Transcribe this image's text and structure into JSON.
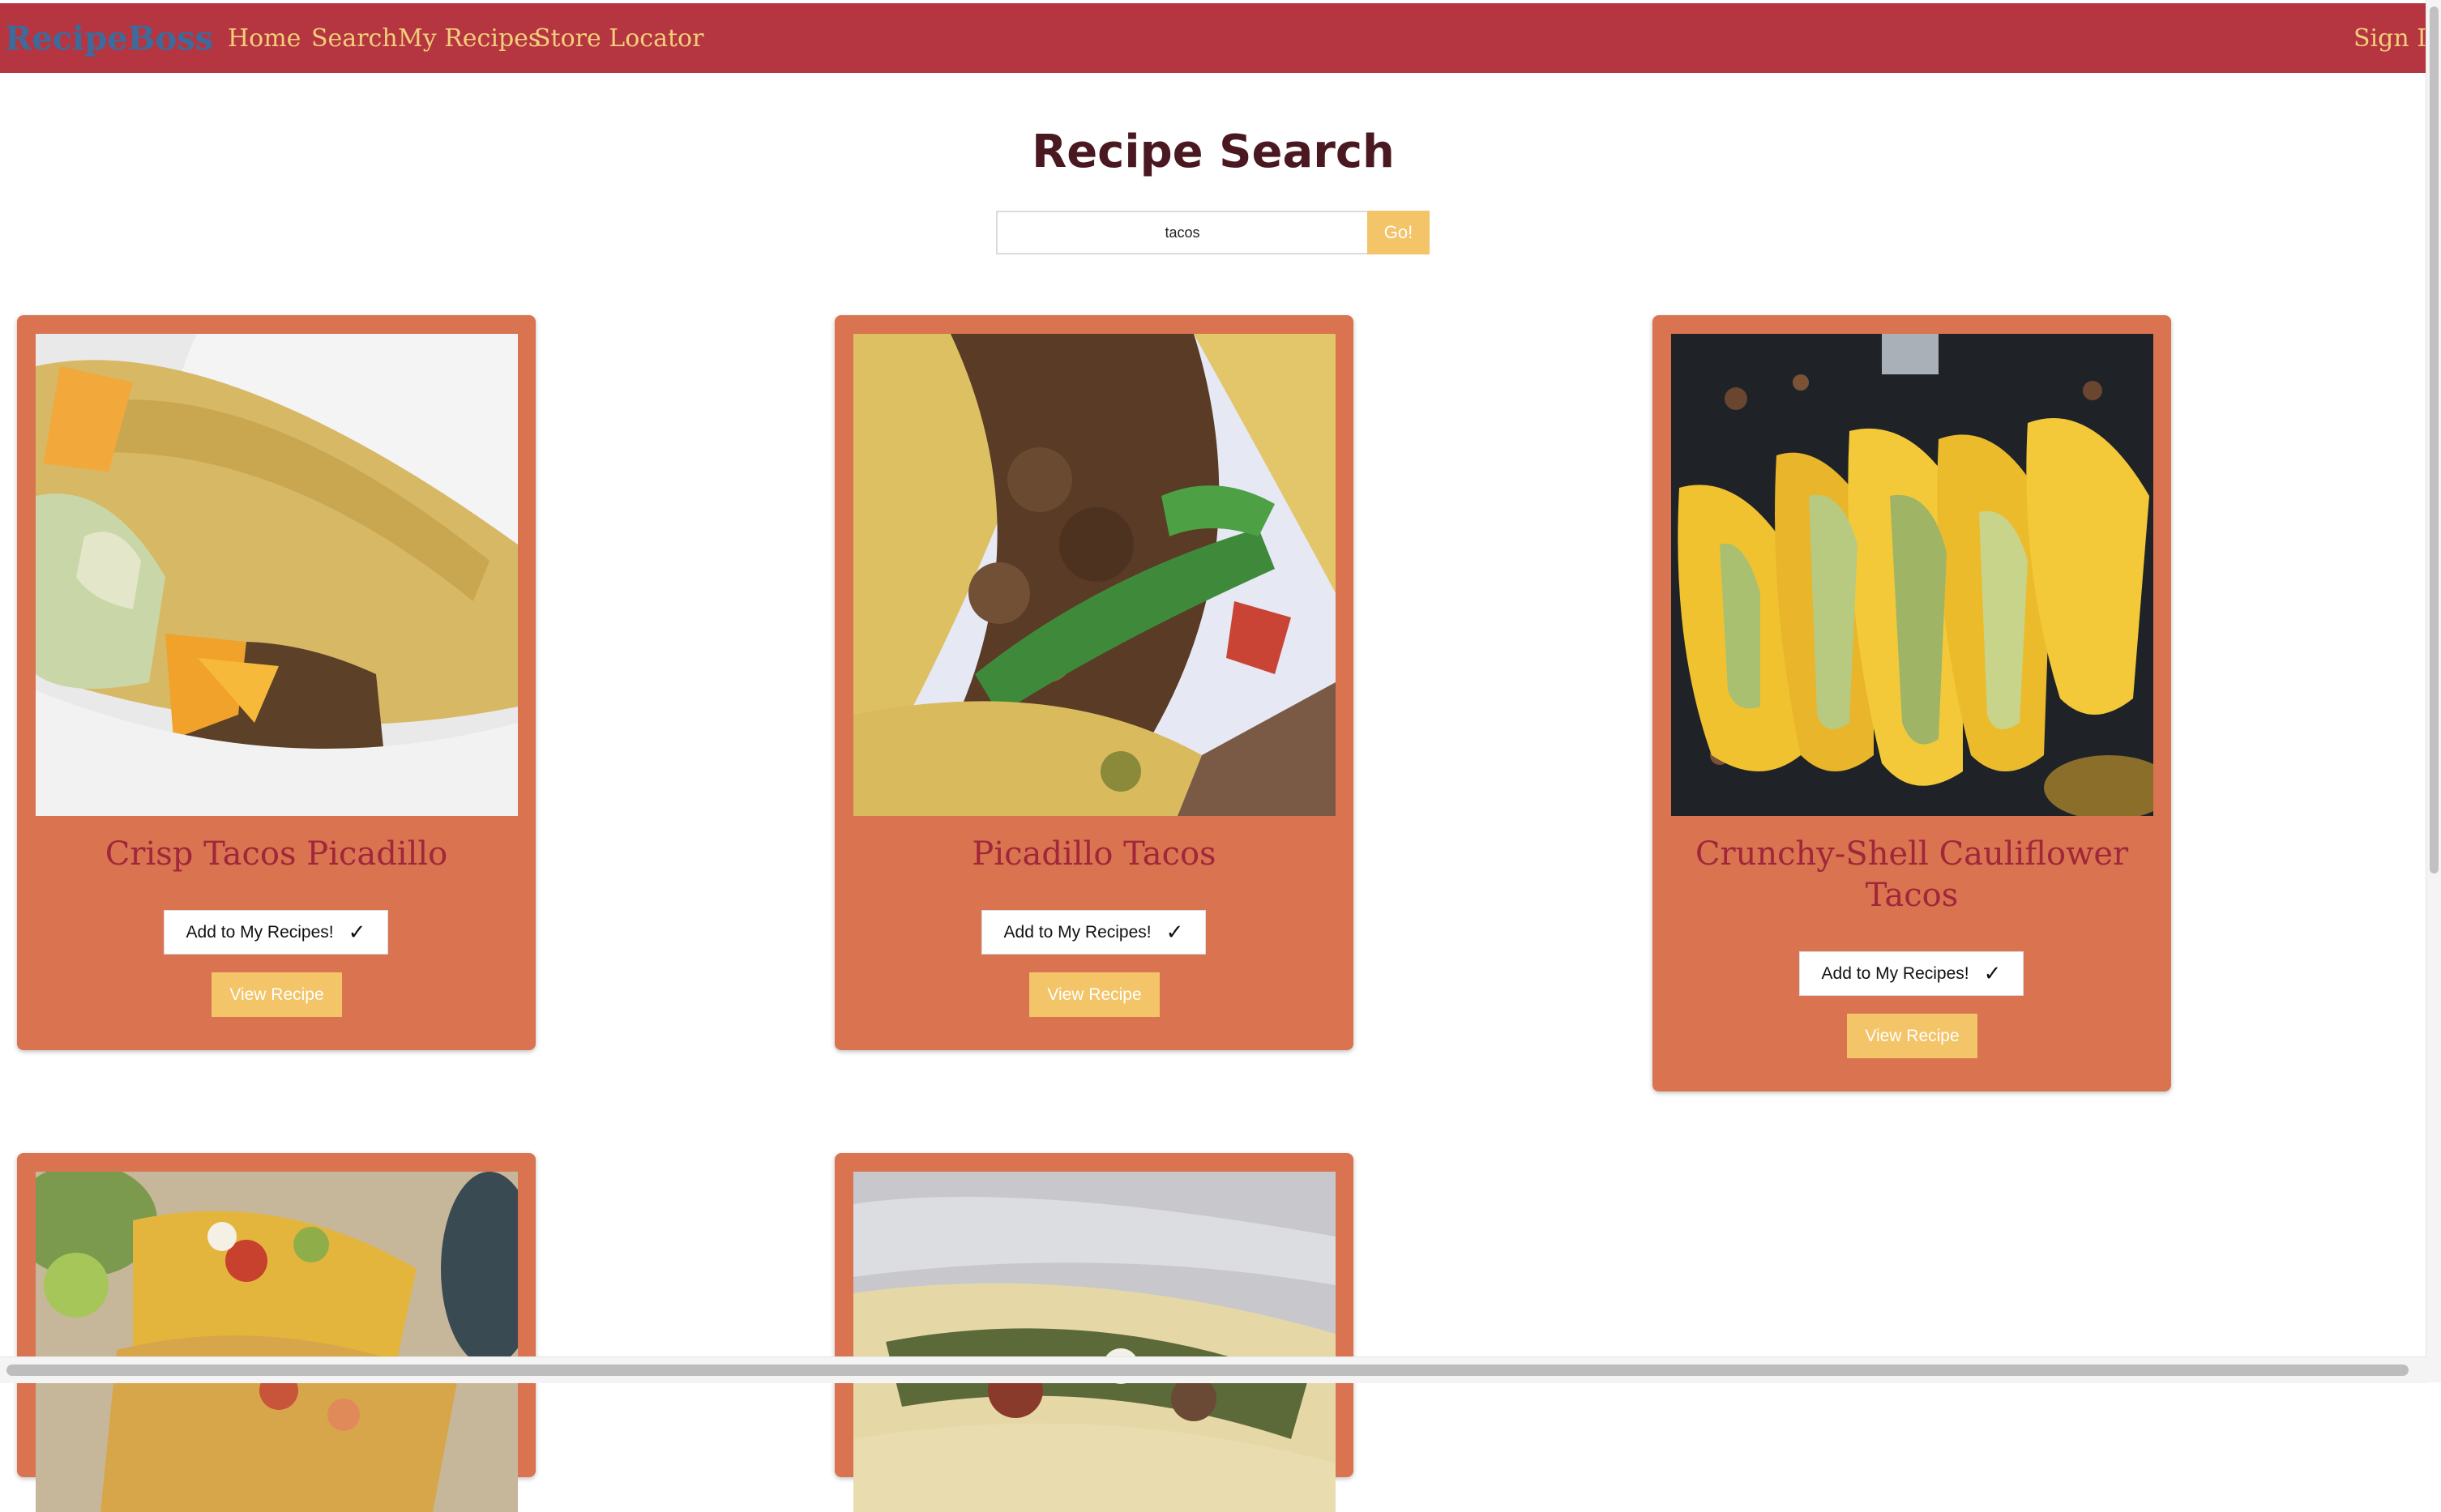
{
  "nav": {
    "brand": "RecipeBoss",
    "links": [
      "Home",
      "Search",
      "My Recipes",
      "Store Locator"
    ],
    "sign_in": "Sign In"
  },
  "page": {
    "title": "Recipe Search"
  },
  "search": {
    "value": "tacos",
    "button_label": "Go!"
  },
  "cards": [
    {
      "title": "Crisp Tacos Picadillo",
      "add_label": "Add to My Recipes!",
      "check": "✓",
      "view_label": "View Recipe"
    },
    {
      "title": "Picadillo Tacos",
      "add_label": "Add to My Recipes!",
      "check": "✓",
      "view_label": "View Recipe"
    },
    {
      "title": "Crunchy-Shell Cauliflower Tacos",
      "add_label": "Add to My Recipes!",
      "check": "✓",
      "view_label": "View Recipe"
    },
    {
      "title": ""
    },
    {
      "title": ""
    }
  ],
  "colors": {
    "nav_background": "#b53540",
    "brand": "#3d6b9c",
    "nav_link": "#f2cf7a",
    "card_background": "#d97350",
    "card_title": "#a0263a",
    "accent_button": "#f3c468",
    "page_title": "#4a1820"
  }
}
